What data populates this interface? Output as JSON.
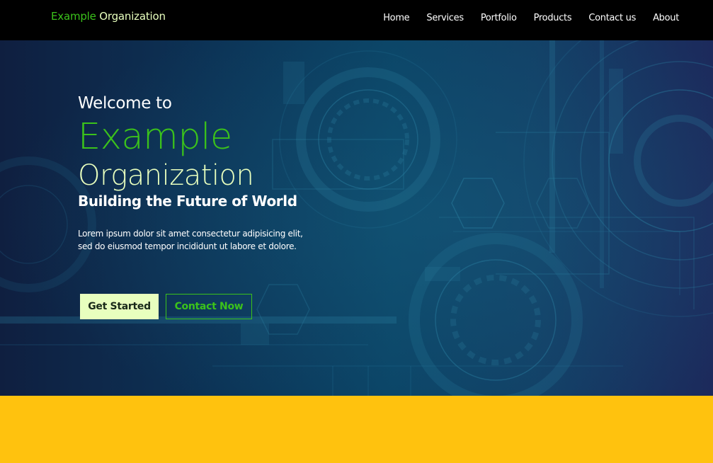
{
  "navbar": {
    "brand_part1": "Example",
    "brand_part2": "Organization",
    "links": [
      "Home",
      "Services",
      "Portfolio",
      "Products",
      "Contact us",
      "About"
    ]
  },
  "hero": {
    "welcome": "Welcome to",
    "title_line1": "Example",
    "title_line2": "Organization",
    "tagline": "Building the Future of World",
    "description": "Lorem ipsum dolor sit amet consectetur adipisicing elit, sed do eiusmod tempor incididunt ut labore et dolore.",
    "primary_button": "Get Started",
    "secondary_button": "Contact Now"
  },
  "colors": {
    "navbar_bg": "#000000",
    "accent_green": "#3bc21b",
    "light_green": "#e8ffbe",
    "band_yellow": "#ffc20e",
    "hero_bg": "#0b4466"
  }
}
